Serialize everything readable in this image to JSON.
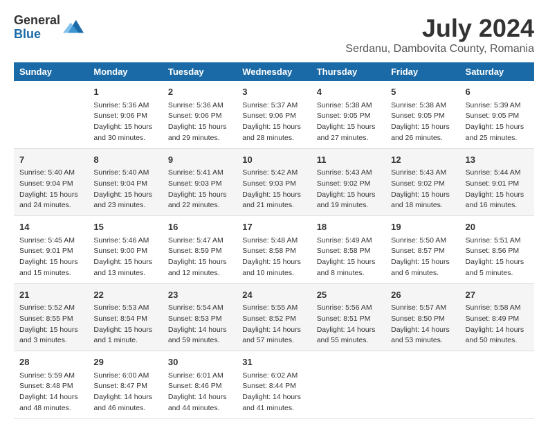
{
  "header": {
    "logo_general": "General",
    "logo_blue": "Blue",
    "month_year": "July 2024",
    "location": "Serdanu, Dambovita County, Romania"
  },
  "days_of_week": [
    "Sunday",
    "Monday",
    "Tuesday",
    "Wednesday",
    "Thursday",
    "Friday",
    "Saturday"
  ],
  "weeks": [
    [
      {
        "day": "",
        "info": ""
      },
      {
        "day": "1",
        "info": "Sunrise: 5:36 AM\nSunset: 9:06 PM\nDaylight: 15 hours\nand 30 minutes."
      },
      {
        "day": "2",
        "info": "Sunrise: 5:36 AM\nSunset: 9:06 PM\nDaylight: 15 hours\nand 29 minutes."
      },
      {
        "day": "3",
        "info": "Sunrise: 5:37 AM\nSunset: 9:06 PM\nDaylight: 15 hours\nand 28 minutes."
      },
      {
        "day": "4",
        "info": "Sunrise: 5:38 AM\nSunset: 9:05 PM\nDaylight: 15 hours\nand 27 minutes."
      },
      {
        "day": "5",
        "info": "Sunrise: 5:38 AM\nSunset: 9:05 PM\nDaylight: 15 hours\nand 26 minutes."
      },
      {
        "day": "6",
        "info": "Sunrise: 5:39 AM\nSunset: 9:05 PM\nDaylight: 15 hours\nand 25 minutes."
      }
    ],
    [
      {
        "day": "7",
        "info": "Sunrise: 5:40 AM\nSunset: 9:04 PM\nDaylight: 15 hours\nand 24 minutes."
      },
      {
        "day": "8",
        "info": "Sunrise: 5:40 AM\nSunset: 9:04 PM\nDaylight: 15 hours\nand 23 minutes."
      },
      {
        "day": "9",
        "info": "Sunrise: 5:41 AM\nSunset: 9:03 PM\nDaylight: 15 hours\nand 22 minutes."
      },
      {
        "day": "10",
        "info": "Sunrise: 5:42 AM\nSunset: 9:03 PM\nDaylight: 15 hours\nand 21 minutes."
      },
      {
        "day": "11",
        "info": "Sunrise: 5:43 AM\nSunset: 9:02 PM\nDaylight: 15 hours\nand 19 minutes."
      },
      {
        "day": "12",
        "info": "Sunrise: 5:43 AM\nSunset: 9:02 PM\nDaylight: 15 hours\nand 18 minutes."
      },
      {
        "day": "13",
        "info": "Sunrise: 5:44 AM\nSunset: 9:01 PM\nDaylight: 15 hours\nand 16 minutes."
      }
    ],
    [
      {
        "day": "14",
        "info": "Sunrise: 5:45 AM\nSunset: 9:01 PM\nDaylight: 15 hours\nand 15 minutes."
      },
      {
        "day": "15",
        "info": "Sunrise: 5:46 AM\nSunset: 9:00 PM\nDaylight: 15 hours\nand 13 minutes."
      },
      {
        "day": "16",
        "info": "Sunrise: 5:47 AM\nSunset: 8:59 PM\nDaylight: 15 hours\nand 12 minutes."
      },
      {
        "day": "17",
        "info": "Sunrise: 5:48 AM\nSunset: 8:58 PM\nDaylight: 15 hours\nand 10 minutes."
      },
      {
        "day": "18",
        "info": "Sunrise: 5:49 AM\nSunset: 8:58 PM\nDaylight: 15 hours\nand 8 minutes."
      },
      {
        "day": "19",
        "info": "Sunrise: 5:50 AM\nSunset: 8:57 PM\nDaylight: 15 hours\nand 6 minutes."
      },
      {
        "day": "20",
        "info": "Sunrise: 5:51 AM\nSunset: 8:56 PM\nDaylight: 15 hours\nand 5 minutes."
      }
    ],
    [
      {
        "day": "21",
        "info": "Sunrise: 5:52 AM\nSunset: 8:55 PM\nDaylight: 15 hours\nand 3 minutes."
      },
      {
        "day": "22",
        "info": "Sunrise: 5:53 AM\nSunset: 8:54 PM\nDaylight: 15 hours\nand 1 minute."
      },
      {
        "day": "23",
        "info": "Sunrise: 5:54 AM\nSunset: 8:53 PM\nDaylight: 14 hours\nand 59 minutes."
      },
      {
        "day": "24",
        "info": "Sunrise: 5:55 AM\nSunset: 8:52 PM\nDaylight: 14 hours\nand 57 minutes."
      },
      {
        "day": "25",
        "info": "Sunrise: 5:56 AM\nSunset: 8:51 PM\nDaylight: 14 hours\nand 55 minutes."
      },
      {
        "day": "26",
        "info": "Sunrise: 5:57 AM\nSunset: 8:50 PM\nDaylight: 14 hours\nand 53 minutes."
      },
      {
        "day": "27",
        "info": "Sunrise: 5:58 AM\nSunset: 8:49 PM\nDaylight: 14 hours\nand 50 minutes."
      }
    ],
    [
      {
        "day": "28",
        "info": "Sunrise: 5:59 AM\nSunset: 8:48 PM\nDaylight: 14 hours\nand 48 minutes."
      },
      {
        "day": "29",
        "info": "Sunrise: 6:00 AM\nSunset: 8:47 PM\nDaylight: 14 hours\nand 46 minutes."
      },
      {
        "day": "30",
        "info": "Sunrise: 6:01 AM\nSunset: 8:46 PM\nDaylight: 14 hours\nand 44 minutes."
      },
      {
        "day": "31",
        "info": "Sunrise: 6:02 AM\nSunset: 8:44 PM\nDaylight: 14 hours\nand 41 minutes."
      },
      {
        "day": "",
        "info": ""
      },
      {
        "day": "",
        "info": ""
      },
      {
        "day": "",
        "info": ""
      }
    ]
  ]
}
